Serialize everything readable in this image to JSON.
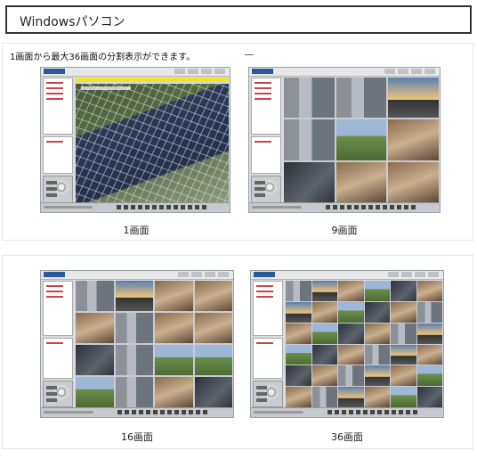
{
  "header": {
    "title": "Windowsパソコン"
  },
  "intro": {
    "text": "1画面から最大36画面の分割表示ができます。"
  },
  "captions": {
    "one": "1画面",
    "nine": "9画面",
    "sixteen": "16画面",
    "thirtysix": "36画面"
  },
  "screens": [
    {
      "name": "single-view",
      "split": 1
    },
    {
      "name": "nine-split-view",
      "split": 9
    },
    {
      "name": "sixteen-split-view",
      "split": 16
    },
    {
      "name": "thirtysix-split-view",
      "split": 36
    }
  ],
  "colors": {
    "header_border": "#333333",
    "panel_border": "#e6e6e6",
    "toolbar_yellow": "#f2e32a"
  }
}
